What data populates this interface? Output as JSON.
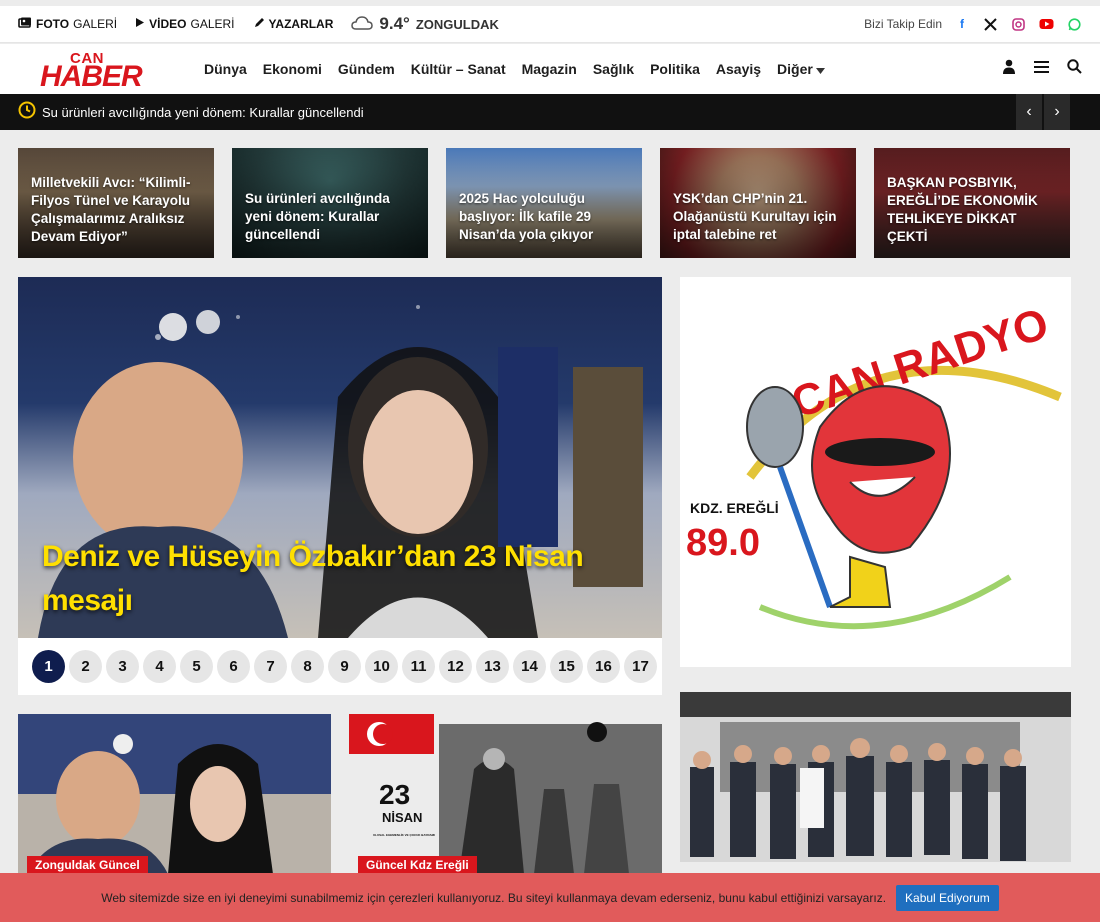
{
  "topbar": {
    "photo_gallery_bold": "FOTO",
    "photo_gallery_rest": "GALERİ",
    "video_gallery_bold": "VİDEO",
    "video_gallery_rest": "GALERİ",
    "authors": "YAZARLAR",
    "weather_temp": "9.4°",
    "weather_city": "ZONGULDAK",
    "follow_label": "Bizi Takip Edin",
    "social": [
      "facebook-icon",
      "x-icon",
      "instagram-icon",
      "youtube-icon",
      "whatsapp-icon"
    ]
  },
  "header": {
    "logo_top": "CAN",
    "logo_main": "HABER",
    "nav": [
      "Dünya",
      "Ekonomi",
      "Gündem",
      "Kültür – Sanat",
      "Magazin",
      "Sağlık",
      "Politika",
      "Asayiş",
      "Diğer"
    ]
  },
  "ticker": {
    "text": "Su ürünleri avcılığında yeni dönem: Kurallar güncellendi"
  },
  "top_cards": [
    {
      "title": "Milletvekili Avcı: “Kilimli-Filyos Tünel ve Karayolu Çalışmalarımız Aralıksız Devam Ediyor”"
    },
    {
      "title": "Su ürünleri avcılığında yeni dönem: Kurallar güncellendi"
    },
    {
      "title": "2025 Hac yolculuğu başlıyor: İlk kafile 29 Nisan’da yola çıkıyor"
    },
    {
      "title": "YSK’dan CHP’nin 21. Olağanüstü Kurultayı için iptal talebine ret"
    },
    {
      "title": "BAŞKAN POSBIYIK, EREĞLİ’DE EKONOMİK TEHLİKEYE DİKKAT ÇEKTİ"
    }
  ],
  "slider": {
    "headline": "Deniz ve Hüseyin Özbakır’dan 23 Nisan mesajı",
    "pages": [
      "1",
      "2",
      "3",
      "4",
      "5",
      "6",
      "7",
      "8",
      "9",
      "10",
      "11",
      "12",
      "13",
      "14",
      "15",
      "16",
      "17"
    ],
    "active_page": "1"
  },
  "radio_ad": {
    "title": "CAN RADYO",
    "location": "KDZ. EREĞLİ",
    "frequency": "89.0"
  },
  "bottom_cards": [
    {
      "tag": "Zonguldak Güncel"
    },
    {
      "tag": "Güncel Kdz Ereğli",
      "overlay_big": "23",
      "overlay_month": "NİSAN",
      "overlay_sub": "ULUSAL EGEMENLİK VE ÇOCUK BAYRAMI"
    }
  ],
  "cookie": {
    "message": "Web sitemizde size en iyi deneyimi sunabilmemiz için çerezleri kullanıyoruz. Bu siteyi kullanmaya devam ederseniz, bunu kabul ettiğinizi varsayarız.",
    "accept": "Kabul Ediyorum"
  },
  "colors": {
    "brand_red": "#d9161d",
    "headline_yellow": "#ffe000",
    "pager_active": "#0f1d4e",
    "cookie_bg": "#e15b5b",
    "cookie_btn": "#1f6fbf"
  }
}
